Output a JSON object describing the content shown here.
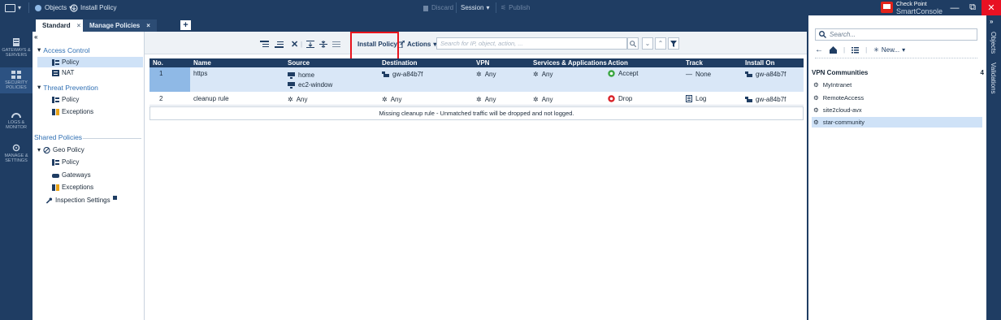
{
  "titlebar": {
    "objects_label": "Objects",
    "install_policy_label": "Install Policy",
    "discard_label": "Discard",
    "session_label": "Session",
    "publish_label": "Publish",
    "brand_top": "Check Point",
    "brand_bottom": "SmartConsole"
  },
  "leftstrip": {
    "items": [
      {
        "label": "GATEWAYS & SERVERS"
      },
      {
        "label": "SECURITY POLICIES"
      },
      {
        "label": "LOGS & MONITOR"
      },
      {
        "label": "MANAGE & SETTINGS"
      }
    ]
  },
  "tabs": {
    "standard": "Standard",
    "manage_policies": "Manage Policies",
    "close_symbol": "×",
    "add_symbol": "+"
  },
  "nav": {
    "collapse": "«",
    "access_control": "Access Control",
    "policy": "Policy",
    "nat": "NAT",
    "threat_prevention": "Threat Prevention",
    "tp_policy": "Policy",
    "tp_exceptions": "Exceptions",
    "shared_policies": "Shared Policies",
    "geo_policy": "Geo Policy",
    "geo_sub_policy": "Policy",
    "geo_gateways": "Gateways",
    "geo_exceptions": "Exceptions",
    "inspection_settings": "Inspection Settings"
  },
  "toolbar": {
    "install_policy": "Install Policy",
    "actions": "Actions",
    "search_placeholder": "Search for IP, object, action, ..."
  },
  "grid": {
    "columns": [
      "No.",
      "Name",
      "Source",
      "Destination",
      "VPN",
      "Services & Applications",
      "Action",
      "Track",
      "Install On"
    ],
    "rows": [
      {
        "no": "1",
        "name": "https",
        "source": [
          "home",
          "ec2-window"
        ],
        "destination": "gw-a84b7f",
        "vpn": "Any",
        "services": "Any",
        "action": "Accept",
        "track": "None",
        "install_on": "gw-a84b7f"
      },
      {
        "no": "2",
        "name": "cleanup rule",
        "source": [
          "Any"
        ],
        "destination": "Any",
        "vpn": "Any",
        "services": "Any",
        "action": "Drop",
        "track": "Log",
        "install_on": "gw-a84b7f"
      }
    ],
    "missing_notice": "Missing cleanup rule - Unmatched traffic will be dropped and not logged."
  },
  "rightpanel": {
    "search_placeholder": "Search...",
    "new_label": "New...",
    "section_title": "VPN Communities",
    "section_count": "4",
    "items": [
      "MyIntranet",
      "RemoteAccess",
      "site2cloud-avx",
      "star-community"
    ],
    "strip_objects": "Objects",
    "strip_validations": "Validations"
  },
  "colors": {
    "navy": "#1f3d63",
    "selection": "#cfe2f7",
    "highlight_box": "#e8141c",
    "accept": "#3aa640",
    "drop": "#d9232a"
  },
  "icons": [
    "search-icon",
    "gateway-icon",
    "host-icon",
    "any-icon",
    "accept-icon",
    "drop-icon",
    "log-icon",
    "gear-icon",
    "filter-icon"
  ]
}
